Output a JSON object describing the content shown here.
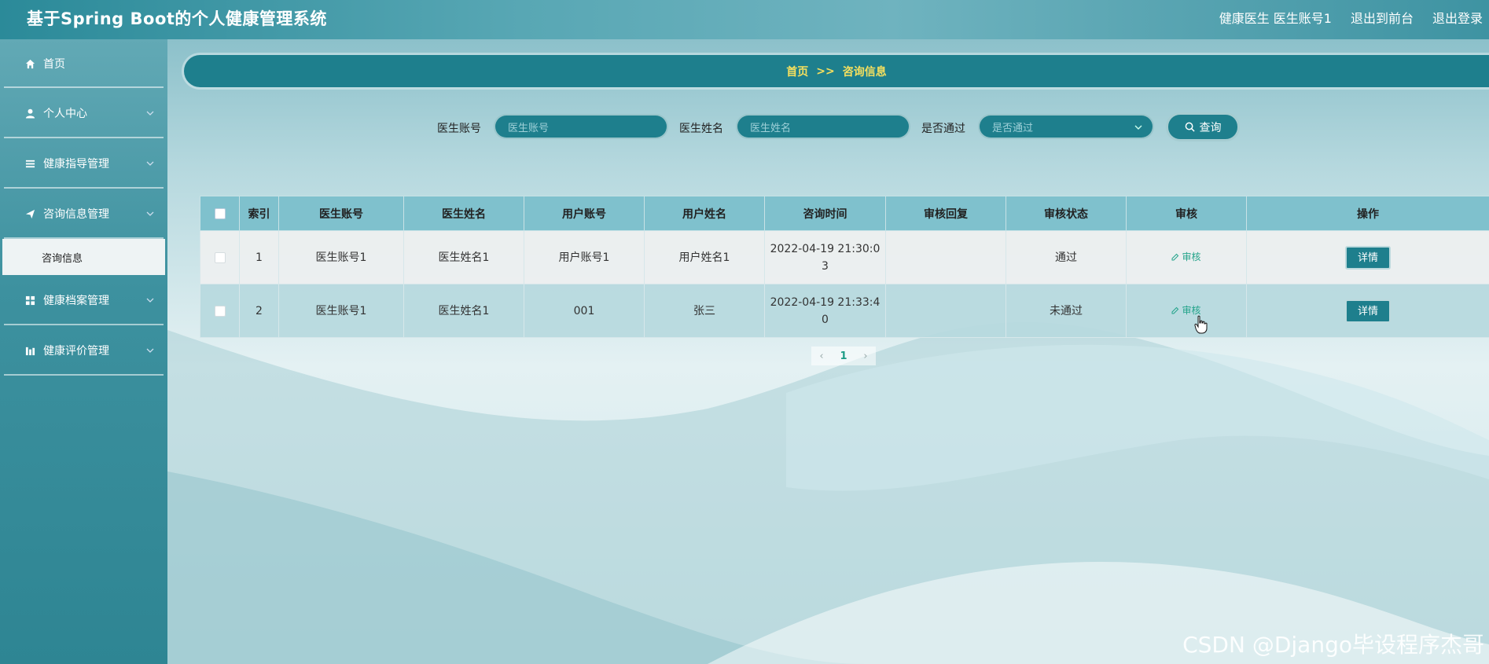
{
  "app": {
    "title": "基于Spring Boot的个人健康管理系统",
    "user_label": "健康医生 医生账号1",
    "back_to_front": "退出到前台",
    "logout": "退出登录"
  },
  "sidebar": {
    "items": [
      {
        "label": "首页",
        "icon": "home-icon"
      },
      {
        "label": "个人中心",
        "icon": "user-icon"
      },
      {
        "label": "健康指导管理",
        "icon": "list-icon"
      },
      {
        "label": "咨询信息管理",
        "icon": "send-icon"
      },
      {
        "label": "健康档案管理",
        "icon": "grid-icon"
      },
      {
        "label": "健康评价管理",
        "icon": "chart-icon"
      }
    ],
    "submenu": {
      "label": "咨询信息"
    }
  },
  "breadcrumb": {
    "home": "首页",
    "separator": ">>",
    "current": "咨询信息"
  },
  "search": {
    "doctor_account_label": "医生账号",
    "doctor_account_placeholder": "医生账号",
    "doctor_name_label": "医生姓名",
    "doctor_name_placeholder": "医生姓名",
    "passed_label": "是否通过",
    "passed_placeholder": "是否通过",
    "search_button": "查询"
  },
  "table": {
    "headers": [
      "索引",
      "医生账号",
      "医生姓名",
      "用户账号",
      "用户姓名",
      "咨询时间",
      "审核回复",
      "审核状态",
      "审核",
      "操作"
    ],
    "rows": [
      {
        "index": "1",
        "doctor_account": "医生账号1",
        "doctor_name": "医生姓名1",
        "user_account": "用户账号1",
        "user_name": "用户姓名1",
        "time_line1": "2022-04-19 21:30:0",
        "time_line2": "3",
        "reply": "",
        "status": "通过",
        "audit_label": "审核",
        "action_label": "详情"
      },
      {
        "index": "2",
        "doctor_account": "医生账号1",
        "doctor_name": "医生姓名1",
        "user_account": "001",
        "user_name": "张三",
        "time_line1": "2022-04-19 21:33:4",
        "time_line2": "0",
        "reply": "",
        "status": "未通过",
        "audit_label": "审核",
        "action_label": "详情"
      }
    ]
  },
  "pagination": {
    "prev": "‹",
    "current": "1",
    "next": "›"
  },
  "watermark": "CSDN @Django毕设程序杰哥"
}
